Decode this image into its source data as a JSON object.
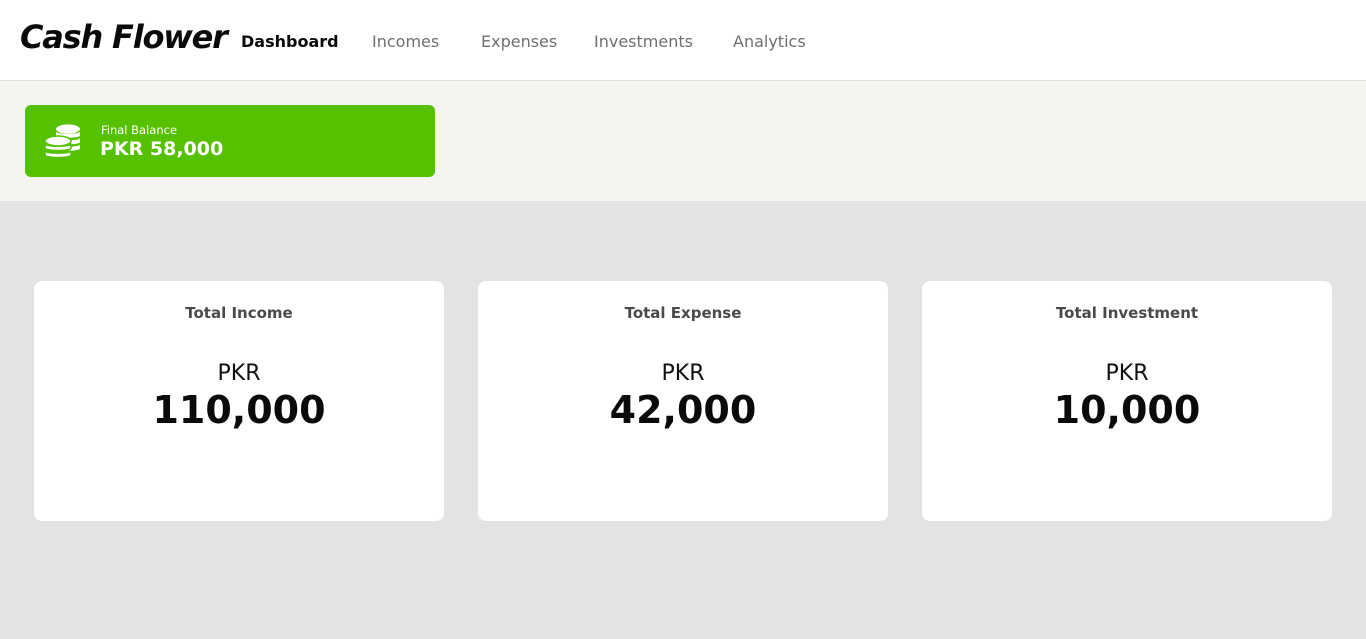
{
  "app": {
    "brand": "Cash Flower"
  },
  "nav": {
    "items": [
      {
        "label": "Dashboard",
        "active": true
      },
      {
        "label": "Incomes",
        "active": false
      },
      {
        "label": "Expenses",
        "active": false
      },
      {
        "label": "Investments",
        "active": false
      },
      {
        "label": "Analytics",
        "active": false
      }
    ]
  },
  "balance": {
    "icon": "coins-stack-icon",
    "label": "Final Balance",
    "value": "PKR 58,000"
  },
  "stats": [
    {
      "title": "Total Income",
      "currency": "PKR",
      "amount": "110,000"
    },
    {
      "title": "Total Expense",
      "currency": "PKR",
      "amount": "42,000"
    },
    {
      "title": "Total Investment",
      "currency": "PKR",
      "amount": "10,000"
    }
  ],
  "colors": {
    "accent": "#56c100",
    "nav_active": "#0b0b0b",
    "nav_inactive": "#6f6f6f",
    "page_bg": "#e3e3e3",
    "band_bg": "#f4f4f0",
    "card_bg": "#ffffff"
  }
}
